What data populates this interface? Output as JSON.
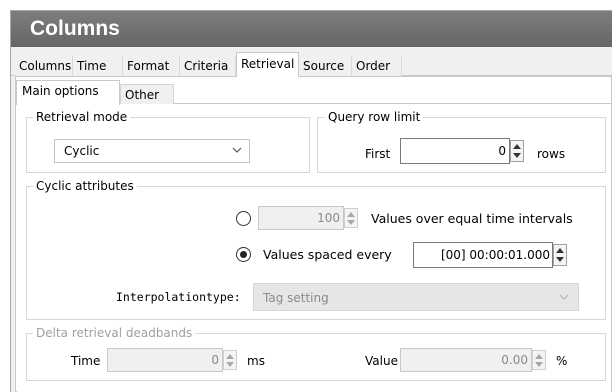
{
  "window": {
    "title": "Columns"
  },
  "tabs": [
    {
      "label": "Columns"
    },
    {
      "label": "Time"
    },
    {
      "label": "Format"
    },
    {
      "label": "Criteria"
    },
    {
      "label": "Retrieval"
    },
    {
      "label": "Source"
    },
    {
      "label": "Order"
    }
  ],
  "subtabs": [
    {
      "label": "Main options"
    },
    {
      "label": "Other"
    }
  ],
  "retrieval_mode": {
    "legend": "Retrieval mode",
    "selected": "Cyclic"
  },
  "query_row_limit": {
    "legend": "Query row limit",
    "first_label": "First",
    "value": "0",
    "unit": "rows"
  },
  "cyclic_attributes": {
    "legend": "Cyclic attributes",
    "equal_intervals_value": "100",
    "equal_intervals_label": "Values over equal time intervals",
    "spaced_every_label": "Values spaced every",
    "spaced_every_value": "[00] 00:00:01.000",
    "interpolation_label": "Interpolationtype:",
    "interpolation_value": "Tag setting"
  },
  "delta_deadbands": {
    "legend": "Delta retrieval deadbands",
    "time_label": "Time",
    "time_value": "0",
    "time_unit": "ms",
    "value_label": "Value",
    "value_value": "0.00",
    "value_unit": "%"
  }
}
